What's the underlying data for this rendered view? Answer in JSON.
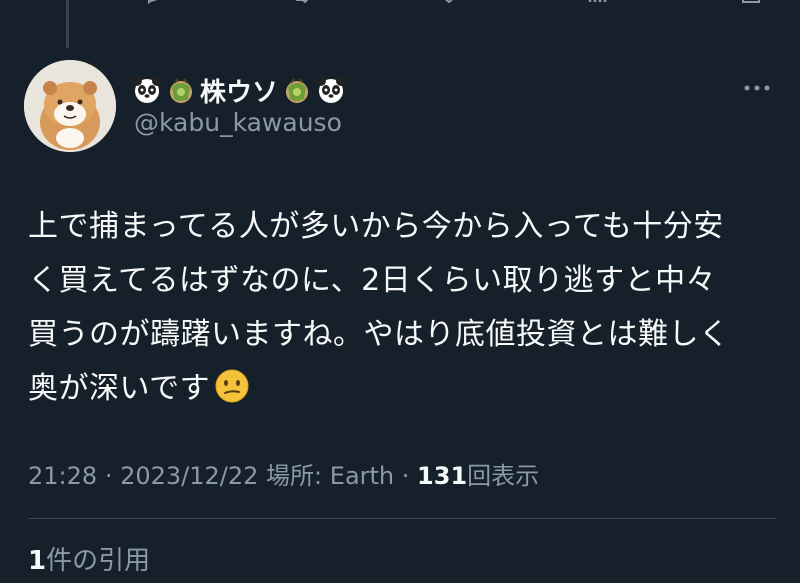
{
  "tweet": {
    "display_name": "株ウソ",
    "name_emojis": [
      "panda-face",
      "avocado-bag",
      "avocado-bag",
      "panda-face"
    ],
    "handle": "@kabu_kawauso",
    "text_lines": [
      "上で捕まってる人が多いから今から入っても十分安",
      "く買えてるはずなのに、2日くらい取り逃すと中々",
      "買うのが躊躇いますね。やはり底値投資とは難しく",
      "奥が深いです"
    ],
    "trailing_emoji": "confused-face",
    "time": "21:28",
    "date": "2023/12/22",
    "location_label": "場所:",
    "location": "Earth",
    "views_count": "131",
    "views_label": "回表示",
    "quotes_count": "1",
    "quotes_label": "件の引用"
  },
  "colors": {
    "background": "#15202b",
    "text_primary": "#f7f9f9",
    "text_secondary": "#8b98a5",
    "divider": "#38444d"
  },
  "icons": [
    "reply-icon",
    "retweet-icon",
    "like-icon",
    "views-icon",
    "share-icon",
    "more-icon"
  ]
}
